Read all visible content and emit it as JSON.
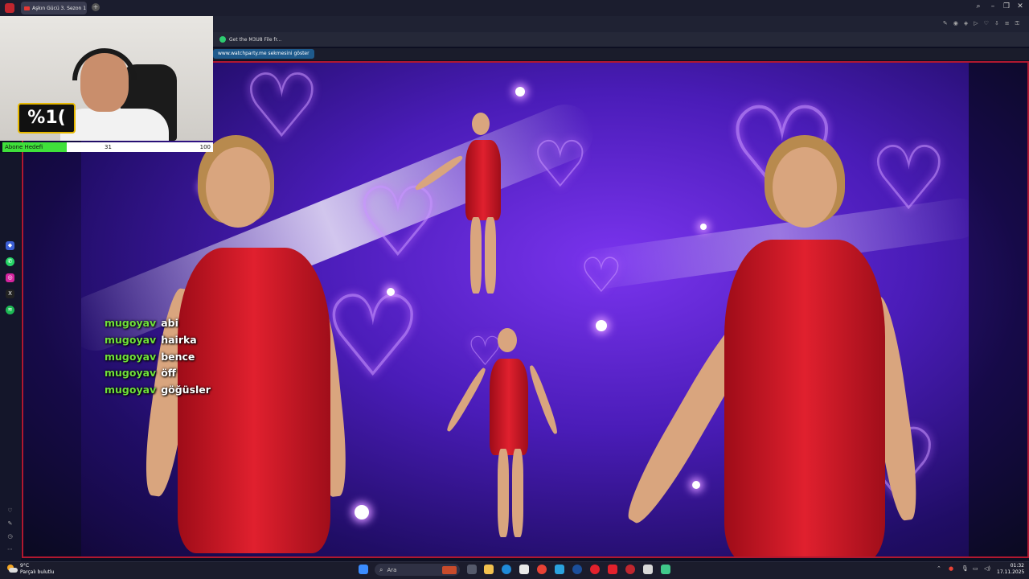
{
  "browser": {
    "tab_title": "Aşkın Gücü 3. Sezon 1",
    "new_tab_icon": "plus-icon",
    "bookmark_label": "Get the M3U8 File fr...",
    "info_tab": "www.watchparty.me sekmesini göster"
  },
  "webcam": {
    "sign_text": "%1("
  },
  "sub_goal": {
    "label": "Abone Hedefi",
    "current": "31",
    "target": "100",
    "progress_fraction": 0.31
  },
  "chat": [
    {
      "user": "mugoyav",
      "message": "abi"
    },
    {
      "user": "mugoyav",
      "message": "hairka"
    },
    {
      "user": "mugoyav",
      "message": "bence"
    },
    {
      "user": "mugoyav",
      "message": "öff"
    },
    {
      "user": "mugoyav",
      "message": "göğüsler"
    }
  ],
  "taskbar": {
    "temperature": "9°C",
    "weather_text": "Parçalı bulutlu",
    "search_placeholder": "Ara",
    "time": "01:32",
    "date": "17.11.2025"
  },
  "colors": {
    "accent_red": "#b01830",
    "chat_user": "#6fe03a",
    "goal_fill": "#3fe03a"
  }
}
